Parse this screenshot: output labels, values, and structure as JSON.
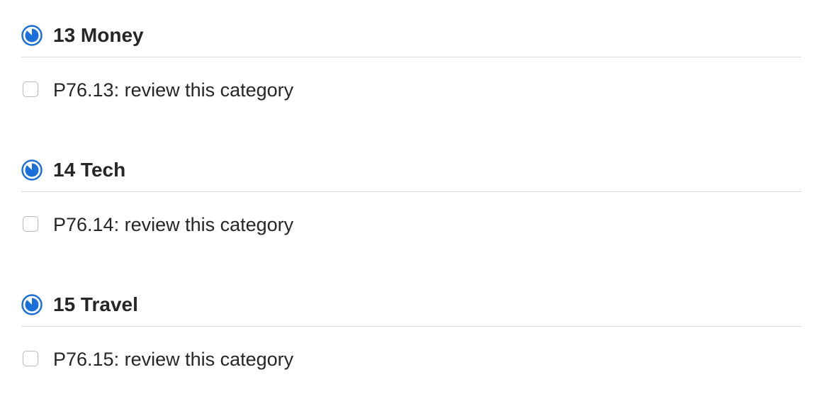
{
  "sections": [
    {
      "title": "13 Money",
      "icon": "progress-clock-icon",
      "tasks": [
        {
          "label": "P76.13: review this category",
          "checked": false
        }
      ]
    },
    {
      "title": "14 Tech",
      "icon": "progress-clock-icon",
      "tasks": [
        {
          "label": "P76.14: review this category",
          "checked": false
        }
      ]
    },
    {
      "title": "15 Travel",
      "icon": "progress-clock-icon",
      "tasks": [
        {
          "label": "P76.15: review this category",
          "checked": false
        }
      ]
    }
  ],
  "colors": {
    "accent": "#1a6fd8",
    "text": "#262626",
    "divider": "#dcdcdc",
    "checkbox_border": "#b9b9b9"
  }
}
